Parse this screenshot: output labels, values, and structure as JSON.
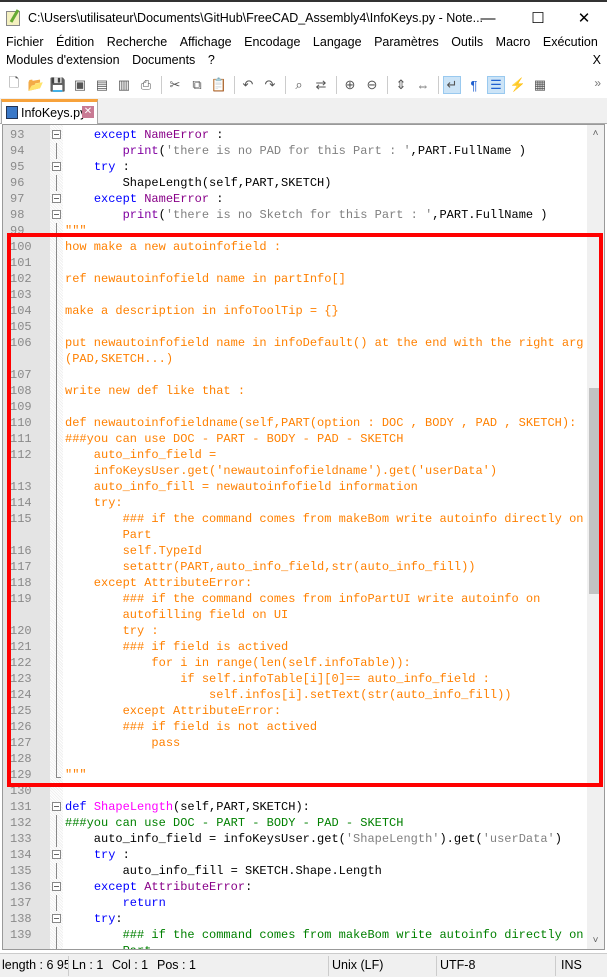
{
  "window": {
    "title": "C:\\Users\\utilisateur\\Documents\\GitHub\\FreeCAD_Assembly4\\InfoKeys.py - Note...",
    "minimize": "—",
    "maximize": "☐",
    "close": "✕"
  },
  "menu": {
    "row1": [
      "Fichier",
      "Édition",
      "Recherche",
      "Affichage",
      "Encodage",
      "Langage",
      "Paramètres",
      "Outils",
      "Macro",
      "Exécution"
    ],
    "row2": [
      "Modules d'extension",
      "Documents",
      "?"
    ],
    "close": "X"
  },
  "toolbar": {
    "icons": [
      "new-file-icon",
      "open-file-icon",
      "save-icon",
      "save-all-icon",
      "close-icon",
      "close-all-icon",
      "print-icon",
      "|",
      "cut-icon",
      "copy-icon",
      "paste-icon",
      "|",
      "undo-icon",
      "redo-icon",
      "|",
      "find-icon",
      "replace-icon",
      "|",
      "zoom-in-icon",
      "zoom-out-icon",
      "|",
      "sync-vertical-icon",
      "sync-horizontal-icon",
      "|",
      "word-wrap-icon",
      "show-all-chars-icon",
      "indent-guide-icon",
      "user-defined-language-icon",
      "document-map-icon"
    ],
    "overflow": "»"
  },
  "tab": {
    "label": "InfoKeys.py",
    "close": "✕"
  },
  "colors": {
    "highlight_box": "#ff0000",
    "keyword": "#0000ff",
    "triple_string": "#ff8000",
    "comment": "#008000",
    "string": "#808080",
    "tab_accent": "#f7a23b"
  },
  "scrollbar": {
    "up": "˄",
    "down": "˅",
    "thumb_fraction": 0.26,
    "position_fraction": 0.42
  },
  "lines": [
    {
      "n": "93",
      "fold": "box",
      "seg": [
        [
          "pl",
          "    "
        ],
        [
          "kw",
          "except"
        ],
        [
          "pl",
          " "
        ],
        [
          "cls",
          "NameError"
        ],
        [
          "pl",
          " :"
        ]
      ]
    },
    {
      "n": "94",
      "fold": "line",
      "seg": [
        [
          "pl",
          "        "
        ],
        [
          "fn",
          "print"
        ],
        [
          "pl",
          "("
        ],
        [
          "str",
          "'there is no PAD for this Part : '"
        ],
        [
          "pl",
          ",PART.FullName )"
        ]
      ]
    },
    {
      "n": "95",
      "fold": "box",
      "seg": [
        [
          "pl",
          "    "
        ],
        [
          "kw",
          "try"
        ],
        [
          "pl",
          " :"
        ]
      ]
    },
    {
      "n": "96",
      "fold": "line",
      "seg": [
        [
          "pl",
          "        ShapeLength(self,PART,SKETCH)"
        ]
      ]
    },
    {
      "n": "97",
      "fold": "box",
      "seg": [
        [
          "pl",
          "    "
        ],
        [
          "kw",
          "except"
        ],
        [
          "pl",
          " "
        ],
        [
          "cls",
          "NameError"
        ],
        [
          "pl",
          " :"
        ]
      ]
    },
    {
      "n": "98",
      "fold": "box",
      "seg": [
        [
          "pl",
          "        "
        ],
        [
          "fn",
          "print"
        ],
        [
          "pl",
          "("
        ],
        [
          "str",
          "'there is no Sketch for this Part : '"
        ],
        [
          "pl",
          ",PART.FullName )"
        ]
      ]
    },
    {
      "n": "99",
      "fold": "line",
      "seg": [
        [
          "tri",
          "\"\"\""
        ]
      ]
    },
    {
      "n": "100",
      "fold": "line",
      "seg": [
        [
          "tri",
          "how make a new autoinfofield :"
        ]
      ]
    },
    {
      "n": "101",
      "fold": "line",
      "seg": [
        [
          "tri",
          ""
        ]
      ]
    },
    {
      "n": "102",
      "fold": "line",
      "seg": [
        [
          "tri",
          "ref newautoinfofield name in partInfo[]"
        ]
      ]
    },
    {
      "n": "103",
      "fold": "line",
      "seg": [
        [
          "tri",
          ""
        ]
      ]
    },
    {
      "n": "104",
      "fold": "line",
      "seg": [
        [
          "tri",
          "make a description in infoToolTip = {}"
        ]
      ]
    },
    {
      "n": "105",
      "fold": "line",
      "seg": [
        [
          "tri",
          ""
        ]
      ]
    },
    {
      "n": "106",
      "fold": "line",
      "seg": [
        [
          "tri",
          "put newautoinfofield name in infoDefault() at the end with the right arg"
        ]
      ]
    },
    {
      "n": "",
      "fold": "line",
      "seg": [
        [
          "tri",
          "(PAD,SKETCH...)"
        ]
      ]
    },
    {
      "n": "107",
      "fold": "line",
      "seg": [
        [
          "tri",
          ""
        ]
      ]
    },
    {
      "n": "108",
      "fold": "line",
      "seg": [
        [
          "tri",
          "write new def like that :"
        ]
      ]
    },
    {
      "n": "109",
      "fold": "line",
      "seg": [
        [
          "tri",
          ""
        ]
      ]
    },
    {
      "n": "110",
      "fold": "line",
      "seg": [
        [
          "tri",
          "def newautoinfofieldname(self,PART(option : DOC , BODY , PAD , SKETCH):"
        ]
      ]
    },
    {
      "n": "111",
      "fold": "line",
      "seg": [
        [
          "tri",
          "###you can use DOC - PART - BODY - PAD - SKETCH"
        ]
      ]
    },
    {
      "n": "112",
      "fold": "line",
      "seg": [
        [
          "tri",
          "    auto_info_field ="
        ]
      ]
    },
    {
      "n": "",
      "fold": "line",
      "seg": [
        [
          "tri",
          "    infoKeysUser.get('newautoinfofieldname').get('userData')"
        ]
      ]
    },
    {
      "n": "113",
      "fold": "line",
      "seg": [
        [
          "tri",
          "    auto_info_fill = newautoinfofield information"
        ]
      ]
    },
    {
      "n": "114",
      "fold": "line",
      "seg": [
        [
          "tri",
          "    try:"
        ]
      ]
    },
    {
      "n": "115",
      "fold": "line",
      "seg": [
        [
          "tri",
          "        ### if the command comes from makeBom write autoinfo directly on"
        ]
      ]
    },
    {
      "n": "",
      "fold": "line",
      "seg": [
        [
          "tri",
          "        Part"
        ]
      ]
    },
    {
      "n": "116",
      "fold": "line",
      "seg": [
        [
          "tri",
          "        self.TypeId"
        ]
      ]
    },
    {
      "n": "117",
      "fold": "line",
      "seg": [
        [
          "tri",
          "        setattr(PART,auto_info_field,str(auto_info_fill))"
        ]
      ]
    },
    {
      "n": "118",
      "fold": "line",
      "seg": [
        [
          "tri",
          "    except AttributeError:"
        ]
      ]
    },
    {
      "n": "119",
      "fold": "line",
      "seg": [
        [
          "tri",
          "        ### if the command comes from infoPartUI write autoinfo on"
        ]
      ]
    },
    {
      "n": "",
      "fold": "line",
      "seg": [
        [
          "tri",
          "        autofilling field on UI"
        ]
      ]
    },
    {
      "n": "120",
      "fold": "line",
      "seg": [
        [
          "tri",
          "        try :"
        ]
      ]
    },
    {
      "n": "121",
      "fold": "line",
      "seg": [
        [
          "tri",
          "        ### if field is actived"
        ]
      ]
    },
    {
      "n": "122",
      "fold": "line",
      "seg": [
        [
          "tri",
          "            for i in range(len(self.infoTable)):"
        ]
      ]
    },
    {
      "n": "123",
      "fold": "line",
      "seg": [
        [
          "tri",
          "                if self.infoTable[i][0]== auto_info_field :"
        ]
      ]
    },
    {
      "n": "124",
      "fold": "line",
      "seg": [
        [
          "tri",
          "                    self.infos[i].setText(str(auto_info_fill))"
        ]
      ]
    },
    {
      "n": "125",
      "fold": "line",
      "seg": [
        [
          "tri",
          "        except AttributeError:"
        ]
      ]
    },
    {
      "n": "126",
      "fold": "line",
      "seg": [
        [
          "tri",
          "        ### if field is not actived"
        ]
      ]
    },
    {
      "n": "127",
      "fold": "line",
      "seg": [
        [
          "tri",
          "            pass"
        ]
      ]
    },
    {
      "n": "128",
      "fold": "line",
      "seg": [
        [
          "tri",
          ""
        ]
      ]
    },
    {
      "n": "129",
      "fold": "end",
      "seg": [
        [
          "tri",
          "\"\"\""
        ]
      ]
    },
    {
      "n": "130",
      "fold": "none",
      "seg": [
        [
          "pl",
          ""
        ]
      ]
    },
    {
      "n": "131",
      "fold": "box",
      "seg": [
        [
          "kw",
          "def"
        ],
        [
          "pl",
          " "
        ],
        [
          "def",
          "ShapeLength"
        ],
        [
          "pl",
          "(self,PART,SKETCH):"
        ]
      ]
    },
    {
      "n": "132",
      "fold": "line",
      "seg": [
        [
          "com",
          "###you can use DOC - PART - BODY - PAD - SKETCH"
        ]
      ]
    },
    {
      "n": "133",
      "fold": "line",
      "seg": [
        [
          "pl",
          "    auto_info_field = infoKeysUser.get("
        ],
        [
          "str",
          "'ShapeLength'"
        ],
        [
          "pl",
          ").get("
        ],
        [
          "str",
          "'userData'"
        ],
        [
          "pl",
          ")"
        ]
      ]
    },
    {
      "n": "134",
      "fold": "box",
      "seg": [
        [
          "pl",
          "    "
        ],
        [
          "kw",
          "try"
        ],
        [
          "pl",
          " :"
        ]
      ]
    },
    {
      "n": "135",
      "fold": "line",
      "seg": [
        [
          "pl",
          "        auto_info_fill = SKETCH.Shape.Length"
        ]
      ]
    },
    {
      "n": "136",
      "fold": "box",
      "seg": [
        [
          "pl",
          "    "
        ],
        [
          "kw",
          "except"
        ],
        [
          "pl",
          " "
        ],
        [
          "cls",
          "AttributeError"
        ],
        [
          "pl",
          ":"
        ]
      ]
    },
    {
      "n": "137",
      "fold": "line",
      "seg": [
        [
          "pl",
          "        "
        ],
        [
          "kw",
          "return"
        ]
      ]
    },
    {
      "n": "138",
      "fold": "box",
      "seg": [
        [
          "pl",
          "    "
        ],
        [
          "kw",
          "try"
        ],
        [
          "pl",
          ":"
        ]
      ]
    },
    {
      "n": "139",
      "fold": "line",
      "seg": [
        [
          "com",
          "        ### if the command comes from makeBom write autoinfo directly on"
        ]
      ]
    },
    {
      "n": "",
      "fold": "line",
      "seg": [
        [
          "com",
          "        Part"
        ]
      ]
    }
  ],
  "status": {
    "length": "length : 6 95",
    "ln": "Ln : 1",
    "col": "Col : 1",
    "pos": "Pos : 1",
    "eol": "Unix (LF)",
    "encoding": "UTF-8",
    "mode": "INS"
  }
}
